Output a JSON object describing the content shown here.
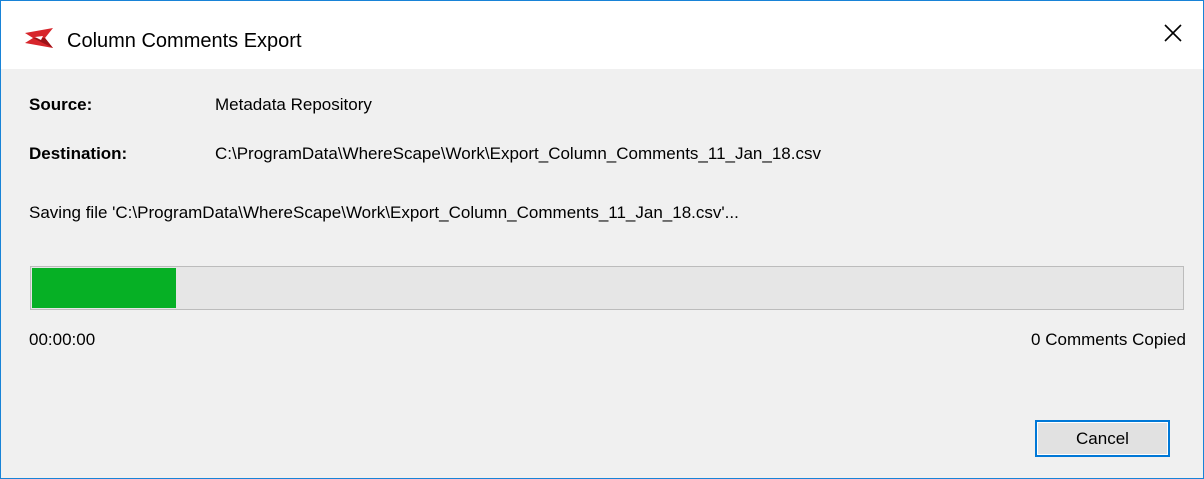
{
  "window": {
    "title": "Column Comments Export",
    "app_icon": "wherescape-logo-icon",
    "close_icon": "close-icon"
  },
  "fields": {
    "source_label": "Source:",
    "source_value": "Metadata Repository",
    "destination_label": "Destination:",
    "destination_value": "C:\\ProgramData\\WhereScape\\Work\\Export_Column_Comments_11_Jan_18.csv"
  },
  "status": {
    "message": "Saving file 'C:\\ProgramData\\WhereScape\\Work\\Export_Column_Comments_11_Jan_18.csv'...",
    "progress_fraction": 0.125,
    "elapsed": "00:00:00",
    "copied_count": "0 Comments Copied"
  },
  "buttons": {
    "cancel_label": "Cancel"
  },
  "colors": {
    "window_border": "#1883d7",
    "progress_fill": "#06b025",
    "button_focus_border": "#0078d7",
    "logo_red": "#d7252b"
  }
}
